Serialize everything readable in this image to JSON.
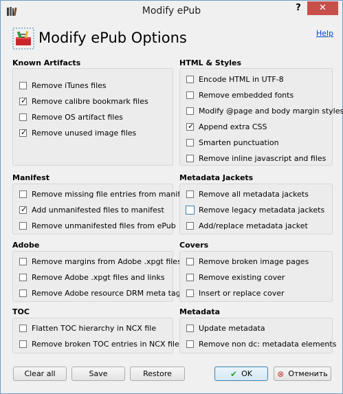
{
  "window": {
    "title": "Modify ePub"
  },
  "header": {
    "title": "Modify ePub Options",
    "help_link": "Help"
  },
  "sections": {
    "known_artifacts": {
      "title": "Known Artifacts",
      "items": [
        {
          "label": "Remove iTunes files",
          "checked": false
        },
        {
          "label": "Remove calibre bookmark files",
          "checked": true
        },
        {
          "label": "Remove OS artifact files",
          "checked": false
        },
        {
          "label": "Remove unused image files",
          "checked": true
        }
      ]
    },
    "html_styles": {
      "title": "HTML & Styles",
      "items": [
        {
          "label": "Encode HTML in UTF-8",
          "checked": false
        },
        {
          "label": "Remove embedded fonts",
          "checked": false
        },
        {
          "label": "Modify @page and body margin styles",
          "checked": false
        },
        {
          "label": "Append extra CSS",
          "checked": true
        },
        {
          "label": "Smarten punctuation",
          "checked": false
        },
        {
          "label": "Remove inline javascript and files",
          "checked": false
        }
      ]
    },
    "manifest": {
      "title": "Manifest",
      "items": [
        {
          "label": "Remove missing file entries from manifest",
          "checked": false
        },
        {
          "label": "Add unmanifested files to manifest",
          "checked": true
        },
        {
          "label": "Remove unmanifested files from ePub",
          "checked": false
        }
      ]
    },
    "metadata_jackets": {
      "title": "Metadata Jackets",
      "items": [
        {
          "label": "Remove all metadata jackets",
          "checked": false
        },
        {
          "label": "Remove legacy metadata jackets",
          "checked": false
        },
        {
          "label": "Add/replace metadata jacket",
          "checked": false
        }
      ]
    },
    "adobe": {
      "title": "Adobe",
      "items": [
        {
          "label": "Remove margins from Adobe .xpgt files",
          "checked": false
        },
        {
          "label": "Remove Adobe .xpgt files and links",
          "checked": false
        },
        {
          "label": "Remove Adobe resource DRM meta tags",
          "checked": false
        }
      ]
    },
    "covers": {
      "title": "Covers",
      "items": [
        {
          "label": "Remove broken image pages",
          "checked": false
        },
        {
          "label": "Remove existing cover",
          "checked": false
        },
        {
          "label": "Insert or replace cover",
          "checked": false
        }
      ]
    },
    "toc": {
      "title": "TOC",
      "items": [
        {
          "label": "Flatten TOC hierarchy in NCX file",
          "checked": false
        },
        {
          "label": "Remove broken TOC entries in NCX file",
          "checked": false
        }
      ]
    },
    "metadata": {
      "title": "Metadata",
      "items": [
        {
          "label": "Update metadata",
          "checked": false
        },
        {
          "label": "Remove non dc: metadata elements",
          "checked": false
        }
      ]
    }
  },
  "buttons": {
    "clear_all": "Clear all",
    "save": "Save",
    "restore": "Restore",
    "ok": "OK",
    "cancel": "Отменить"
  },
  "colors": {
    "close_red": "#c7504b",
    "link_blue": "#0044cc",
    "ok_green": "#2a9d2a",
    "cancel_red": "#c0392b"
  }
}
